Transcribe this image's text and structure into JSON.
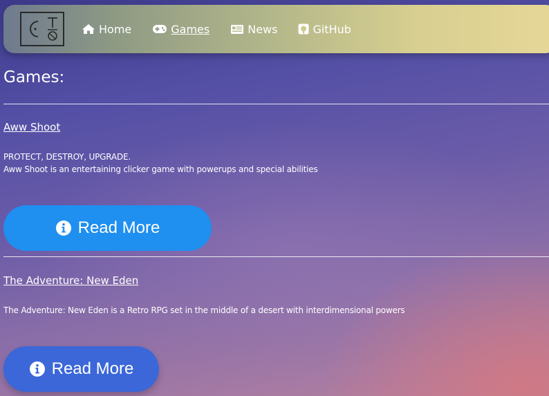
{
  "nav": {
    "items": [
      {
        "label": "Home",
        "icon": "home-icon"
      },
      {
        "label": "Games",
        "icon": "gamepad-icon",
        "active": true
      },
      {
        "label": "News",
        "icon": "newspaper-icon"
      },
      {
        "label": "GitHub",
        "icon": "github-icon"
      }
    ]
  },
  "page": {
    "title": "Games:"
  },
  "games": [
    {
      "title": "Aww Shoot",
      "tagline": "PROTECT, DESTROY, UPGRADE.",
      "description": "Aww Shoot is an entertaining clicker game with powerups and special abilities",
      "button_label": "Read More"
    },
    {
      "title": "The Adventure: New Eden",
      "description": "The Adventure: New Eden is a Retro RPG set in the middle of a desert with interdimensional powers",
      "button_label": "Read More"
    }
  ],
  "colors": {
    "primary_button": "#1f8ff0",
    "secondary_button": "#3b67d8"
  }
}
